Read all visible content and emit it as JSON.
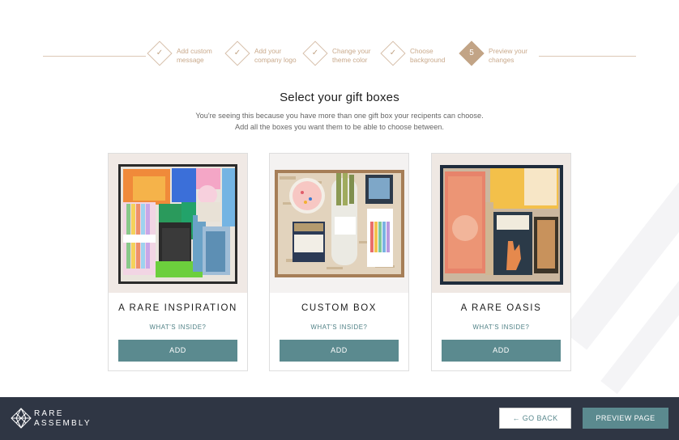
{
  "stepper": {
    "steps": [
      {
        "label": "Add custom\nmessage",
        "state": "done",
        "icon": "check-icon"
      },
      {
        "label": "Add your\ncompany logo",
        "state": "done",
        "icon": "check-icon"
      },
      {
        "label": "Change your\ntheme color",
        "state": "done",
        "icon": "check-icon"
      },
      {
        "label": "Choose\nbackground",
        "state": "done",
        "icon": "check-icon"
      },
      {
        "label": "Preview your\nchanges",
        "state": "active",
        "number": "5"
      }
    ]
  },
  "main": {
    "title": "Select your gift boxes",
    "subtitle_line1": "You're seeing this because you have more than one gift box your recipents can choose.",
    "subtitle_line2": "Add all the boxes you want them to be able to choose between."
  },
  "cards": [
    {
      "title": "A RARE INSPIRATION",
      "link": "WHAT'S INSIDE?",
      "button": "ADD"
    },
    {
      "title": "CUSTOM BOX",
      "link": "WHAT'S INSIDE?",
      "button": "ADD"
    },
    {
      "title": "A RARE OASIS",
      "link": "WHAT'S INSIDE?",
      "button": "ADD"
    }
  ],
  "footer": {
    "logo_text": "RARE\nASSEMBLY",
    "back_label": "GO BACK",
    "back_icon": "arrow-left-icon",
    "preview_label": "PREVIEW PAGE"
  },
  "colors": {
    "accent": "#5b8a8f",
    "tan": "#c2a486",
    "footer_bg": "#2f3644"
  }
}
